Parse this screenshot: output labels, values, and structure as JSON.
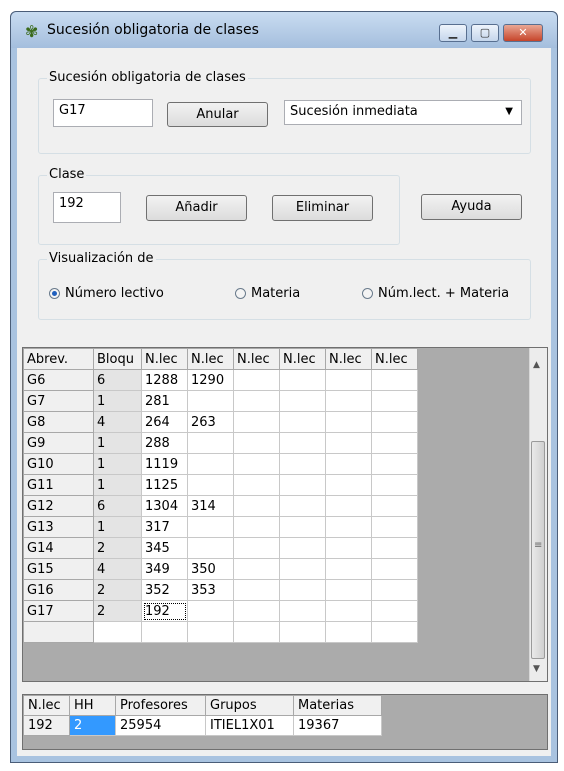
{
  "window": {
    "title": "Sucesión obligatoria de clases",
    "minimize": "▁",
    "maximize": "▢",
    "close": "✕"
  },
  "sucesion": {
    "group_label": "Sucesión obligatoria de clases",
    "code_value": "G17",
    "anular_label": "Anular",
    "dropdown_value": "Sucesión inmediata"
  },
  "clase": {
    "group_label": "Clase",
    "value": "192",
    "add_label": "Añadir",
    "delete_label": "Eliminar",
    "help_label": "Ayuda"
  },
  "visual": {
    "group_label": "Visualización de",
    "options": [
      "Número lectivo",
      "Materia",
      "Núm.lect. + Materia"
    ],
    "selected": "Número lectivo"
  },
  "grid": {
    "headers": [
      "Abrev.",
      "Bloqu",
      "N.lec",
      "N.lec",
      "N.lec",
      "N.lec",
      "N.lec",
      "N.lec"
    ],
    "rows": [
      [
        "G6",
        "6",
        "1288",
        "1290",
        "",
        "",
        "",
        ""
      ],
      [
        "G7",
        "1",
        "281",
        "",
        "",
        "",
        "",
        ""
      ],
      [
        "G8",
        "4",
        "264",
        "263",
        "",
        "",
        "",
        ""
      ],
      [
        "G9",
        "1",
        "288",
        "",
        "",
        "",
        "",
        ""
      ],
      [
        "G10",
        "1",
        "1119",
        "",
        "",
        "",
        "",
        ""
      ],
      [
        "G11",
        "1",
        "1125",
        "",
        "",
        "",
        "",
        ""
      ],
      [
        "G12",
        "6",
        "1304",
        "314",
        "",
        "",
        "",
        ""
      ],
      [
        "G13",
        "1",
        "317",
        "",
        "",
        "",
        "",
        ""
      ],
      [
        "G14",
        "2",
        "345",
        "",
        "",
        "",
        "",
        ""
      ],
      [
        "G15",
        "4",
        "349",
        "350",
        "",
        "",
        "",
        ""
      ],
      [
        "G16",
        "2",
        "352",
        "353",
        "",
        "",
        "",
        ""
      ],
      [
        "G17",
        "2",
        "192",
        "",
        "",
        "",
        "",
        ""
      ],
      [
        "",
        "",
        "",
        "",
        "",
        "",
        "",
        ""
      ]
    ],
    "scroll_up": "▲",
    "scroll_down": "▼",
    "scroll_grip": "≡"
  },
  "bottom": {
    "headers": [
      "N.lec",
      "HH",
      "Profesores",
      "Grupos",
      "Materias"
    ],
    "row": [
      "192",
      "2",
      "25954",
      "ITIEL1X01",
      "19367"
    ]
  }
}
